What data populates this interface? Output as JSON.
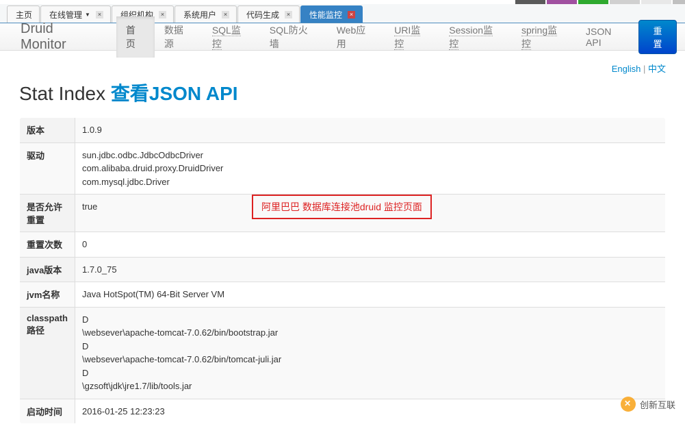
{
  "tabs": {
    "items": [
      {
        "label": "主页",
        "closable": false,
        "active": false
      },
      {
        "label": "在线管理",
        "closable": true,
        "active": false,
        "dropdown": true
      },
      {
        "label": "组织机构",
        "closable": true,
        "active": false
      },
      {
        "label": "系统用户",
        "closable": true,
        "active": false
      },
      {
        "label": "代码生成",
        "closable": true,
        "active": false
      },
      {
        "label": "性能监控",
        "closable": true,
        "active": true
      }
    ]
  },
  "nav": {
    "brand": "Druid Monitor",
    "items": [
      {
        "label": "首页",
        "active": true
      },
      {
        "label": "数据源",
        "active": false
      },
      {
        "label": "SQL监控",
        "active": false,
        "underline": true
      },
      {
        "label": "SQL防火墙",
        "active": false
      },
      {
        "label": "Web应用",
        "active": false
      },
      {
        "label": "URI监控",
        "active": false,
        "underline": true
      },
      {
        "label": "Session监控",
        "active": false,
        "underline": true
      },
      {
        "label": "spring监控",
        "active": false,
        "underline": true
      },
      {
        "label": "JSON API",
        "active": false
      }
    ],
    "reset_label": "重置"
  },
  "lang": {
    "english": "English",
    "sep": " | ",
    "chinese": "中文"
  },
  "title": {
    "text": "Stat Index ",
    "link": "查看JSON API"
  },
  "rows": [
    {
      "key": "版本",
      "value": "1.0.9"
    },
    {
      "key": "驱动",
      "value": "sun.jdbc.odbc.JdbcOdbcDriver\ncom.alibaba.druid.proxy.DruidDriver\ncom.mysql.jdbc.Driver"
    },
    {
      "key": "是否允许重置",
      "value": "true"
    },
    {
      "key": "重置次数",
      "value": "0"
    },
    {
      "key": "java版本",
      "value": "1.7.0_75"
    },
    {
      "key": "jvm名称",
      "value": "Java HotSpot(TM) 64-Bit Server VM"
    },
    {
      "key": "classpath路径",
      "value": "D\n\\websever\\apache-tomcat-7.0.62/bin/bootstrap.jar\nD\n\\websever\\apache-tomcat-7.0.62/bin/tomcat-juli.jar\nD\n\\gzsoft\\jdk\\jre1.7/lib/tools.jar"
    },
    {
      "key": "启动时间",
      "value": "2016-01-25 12:23:23"
    }
  ],
  "callout": "阿里巴巴 数据库连接池druid 监控页面",
  "watermark": "创新互联"
}
